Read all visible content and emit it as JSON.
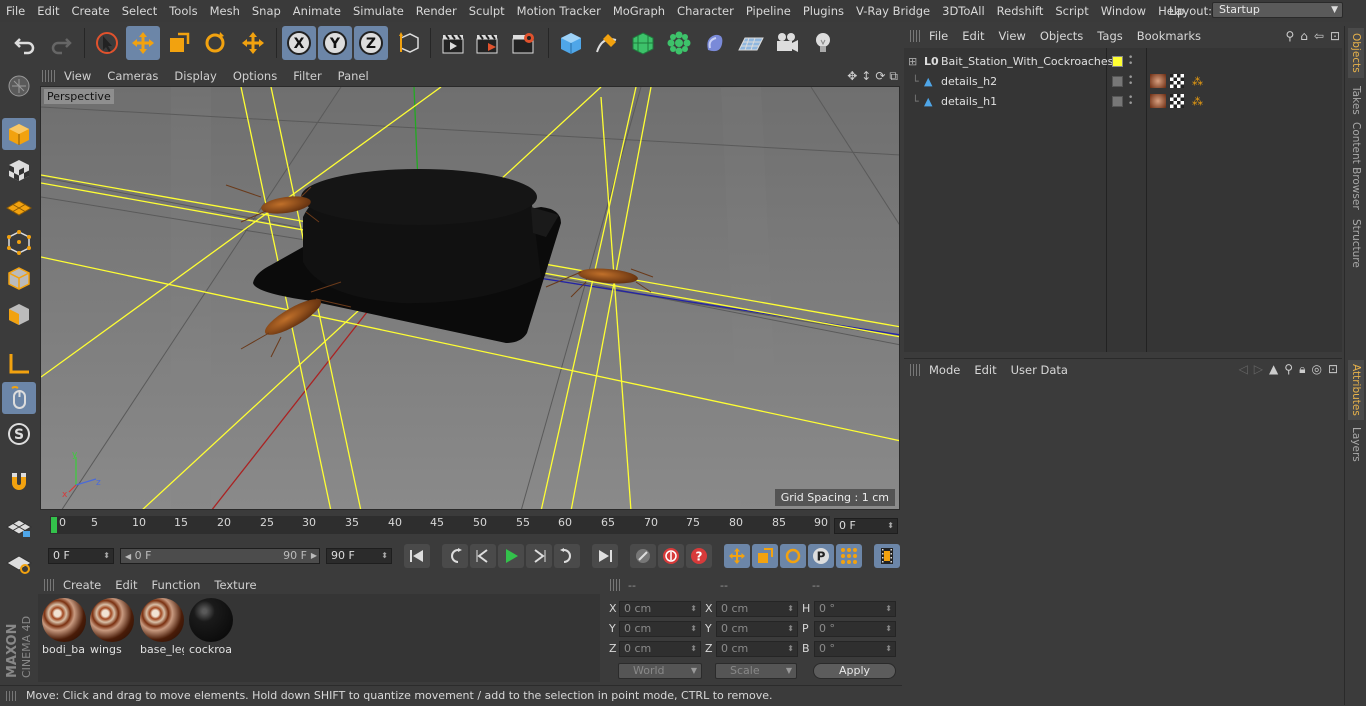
{
  "menubar": {
    "items": [
      "File",
      "Edit",
      "Create",
      "Select",
      "Tools",
      "Mesh",
      "Snap",
      "Animate",
      "Simulate",
      "Render",
      "Sculpt",
      "Motion Tracker",
      "MoGraph",
      "Character",
      "Pipeline",
      "Plugins",
      "V-Ray Bridge",
      "3DToAll",
      "Redshift",
      "Script",
      "Window",
      "Help"
    ],
    "layout_label": "Layout:",
    "layout_value": "Startup"
  },
  "viewport": {
    "menu": [
      "View",
      "Cameras",
      "Display",
      "Options",
      "Filter",
      "Panel"
    ],
    "label": "Perspective",
    "grid_spacing": "Grid Spacing : 1 cm"
  },
  "timeline": {
    "ticks": [
      "0",
      "5",
      "10",
      "15",
      "20",
      "25",
      "30",
      "35",
      "40",
      "45",
      "50",
      "55",
      "60",
      "65",
      "70",
      "75",
      "80",
      "85",
      "90"
    ],
    "frame_end_field": "0 F"
  },
  "transport": {
    "current_frame": "0 F",
    "range_start": "0 F",
    "range_end": "90 F",
    "max_frame": "90 F"
  },
  "materials": {
    "menu": [
      "Create",
      "Edit",
      "Function",
      "Texture"
    ],
    "items": [
      {
        "name": "bodi_ba"
      },
      {
        "name": "wings"
      },
      {
        "name": "base_leg"
      },
      {
        "name": "cockroa"
      }
    ]
  },
  "coordinates": {
    "headers": [
      "--",
      "--",
      "--"
    ],
    "rows": [
      {
        "l1": "X",
        "v1": "0 cm",
        "l2": "X",
        "v2": "0 cm",
        "l3": "H",
        "v3": "0 °"
      },
      {
        "l1": "Y",
        "v1": "0 cm",
        "l2": "Y",
        "v2": "0 cm",
        "l3": "P",
        "v3": "0 °"
      },
      {
        "l1": "Z",
        "v1": "0 cm",
        "l2": "Z",
        "v2": "0 cm",
        "l3": "B",
        "v3": "0 °"
      }
    ],
    "mode_dropdown": "World",
    "scale_dropdown": "Scale",
    "apply_label": "Apply"
  },
  "status": {
    "text": "Move: Click and drag to move elements. Hold down SHIFT to quantize movement / add to the selection in point mode, CTRL to remove."
  },
  "object_manager": {
    "menu": [
      "File",
      "Edit",
      "View",
      "Objects",
      "Tags",
      "Bookmarks"
    ],
    "objects": [
      {
        "name": "Bait_Station_With_Cockroaches",
        "icon": "null-object-icon"
      },
      {
        "name": "details_h2",
        "icon": "polygon-object-icon"
      },
      {
        "name": "details_h1",
        "icon": "polygon-object-icon"
      }
    ]
  },
  "attributes": {
    "menu": [
      "Mode",
      "Edit",
      "User Data"
    ]
  },
  "right_tabs": {
    "top": [
      "Objects",
      "Takes",
      "Content Browser",
      "Structure"
    ],
    "bottom": [
      "Attributes",
      "Layers"
    ]
  },
  "brand": {
    "logo_text": "MAXON CINEMA 4D"
  },
  "colors": {
    "accent_blue": "#6c86a8",
    "playhead_green": "#33c24b",
    "viewport_bg": "#7d7d7d",
    "selection_yellow": "#ffff33"
  }
}
